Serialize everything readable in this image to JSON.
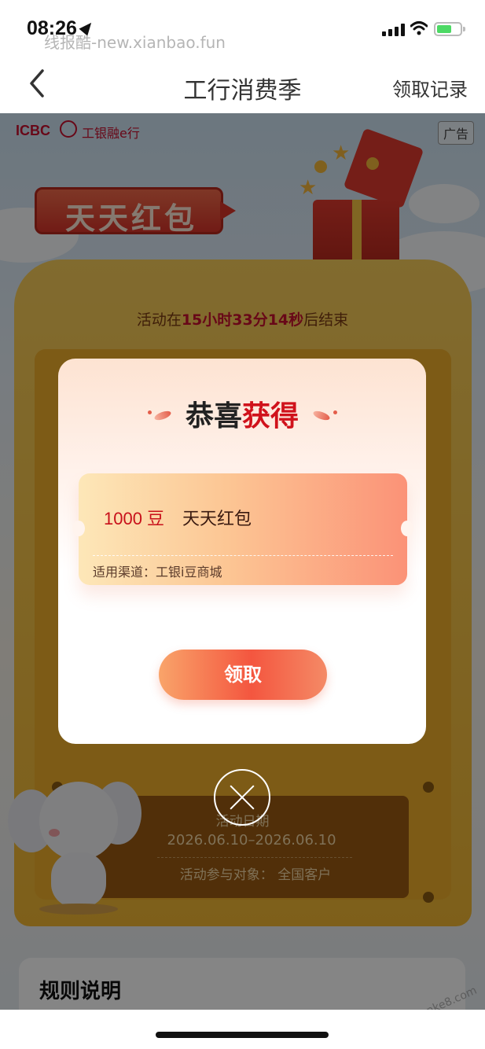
{
  "status_bar": {
    "time": "08:26",
    "watermark": "线报酷-new.xianbao.fun",
    "battery_color": "#4cd964"
  },
  "nav": {
    "back_icon": "chevron-left-icon",
    "title": "工行消费季",
    "right_label": "领取记录"
  },
  "background": {
    "brand_name": "ICBC",
    "brand_cn": "工银融e行",
    "ad_tag": "广告",
    "banner_text": "天天红包",
    "countdown": {
      "prefix": "活动在",
      "time": "15小时33分14秒",
      "suffix": "后结束"
    },
    "activity_date_label": "活动日期",
    "activity_date": "2026.06.10–2026.06.10",
    "activity_target": "活动参与对象：   全国客户",
    "rules_title": "规则说明",
    "watermark_bottom": "赚客吧 www.zuanke8.com"
  },
  "modal": {
    "title_part1": "恭喜",
    "title_part2": "获得",
    "coupon": {
      "amount": "1000 豆",
      "name": "天天红包",
      "channel": "适用渠道：工银i豆商城"
    },
    "claim_button": "领取",
    "close_icon": "close-icon",
    "accent_color": "#d0121b"
  }
}
